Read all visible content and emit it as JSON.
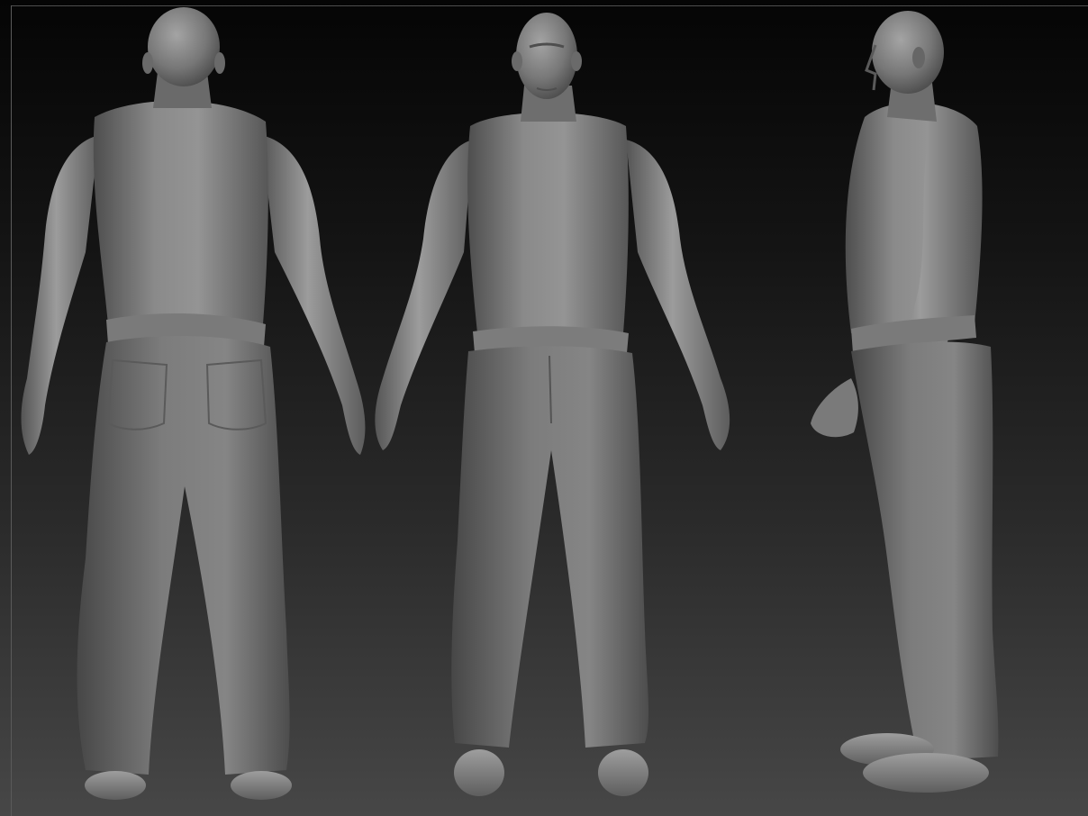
{
  "document": {
    "views": [
      {
        "name": "back-view"
      },
      {
        "name": "front-view"
      },
      {
        "name": "side-view"
      }
    ]
  },
  "colors": {
    "background_top": "#050505",
    "background_bottom": "#474747",
    "clay_light": "#9a9a9a",
    "clay_mid": "#6e6e6e",
    "clay_dark": "#3e3e3e",
    "frame": "#5a5a5a"
  }
}
